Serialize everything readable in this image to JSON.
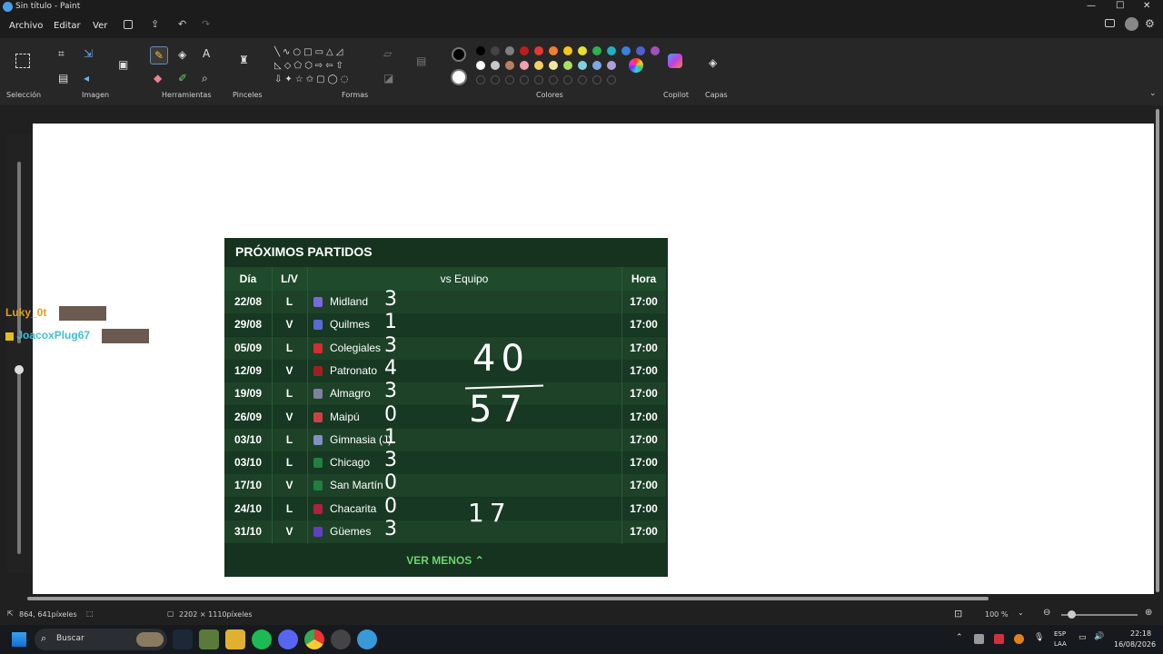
{
  "window": {
    "title": "Sin título - Paint",
    "controls": [
      "—",
      "□",
      "✕"
    ]
  },
  "menu": [
    "Archivo",
    "Editar",
    "Ver"
  ],
  "ribbon": {
    "groups": [
      "Selección",
      "Imagen",
      "Herramientas",
      "Pinceles",
      "Formas",
      "Colores",
      "Copilot",
      "Capas"
    ],
    "palette_row1": [
      "#000000",
      "#444444",
      "#7f7f7f",
      "#c01c1c",
      "#e53935",
      "#f08030",
      "#f5c518",
      "#e8e030",
      "#30b050",
      "#20b0c0",
      "#3a80e0",
      "#5060d0",
      "#a050c0"
    ],
    "palette_row2": [
      "#ffffff",
      "#c8c8c8",
      "#b88060",
      "#f0a0b0",
      "#f5d060",
      "#f0e8a0",
      "#a8e060",
      "#80d0e0",
      "#80a8e0",
      "#b0a0d8"
    ]
  },
  "chat": [
    {
      "user": "Luky_0t",
      "color": "#e0a020"
    },
    {
      "user": "JoacoxPlug67",
      "color": "#40c0d0"
    }
  ],
  "widget": {
    "title": "PRÓXIMOS PARTIDOS",
    "columns": [
      "Día",
      "L/V",
      "vs Equipo",
      "Hora"
    ],
    "rows": [
      {
        "dia": "22/08",
        "lv": "L",
        "equipo": "Midland",
        "hora": "17:00",
        "score": "3",
        "crest": "#7a6ad8"
      },
      {
        "dia": "29/08",
        "lv": "V",
        "equipo": "Quilmes",
        "hora": "17:00",
        "score": "1",
        "crest": "#5a6ad0"
      },
      {
        "dia": "05/09",
        "lv": "L",
        "equipo": "Colegiales",
        "hora": "17:00",
        "score": "3",
        "crest": "#d03030"
      },
      {
        "dia": "12/09",
        "lv": "V",
        "equipo": "Patronato",
        "hora": "17:00",
        "score": "4",
        "crest": "#a02020"
      },
      {
        "dia": "19/09",
        "lv": "L",
        "equipo": "Almagro",
        "hora": "17:00",
        "score": "3",
        "crest": "#8080a0"
      },
      {
        "dia": "26/09",
        "lv": "V",
        "equipo": "Maipú",
        "hora": "17:00",
        "score": "0",
        "crest": "#d04040"
      },
      {
        "dia": "03/10",
        "lv": "L",
        "equipo": "Gimnasia (J)",
        "hora": "17:00",
        "score": "1",
        "crest": "#8090c0"
      },
      {
        "dia": "03/10",
        "lv": "L",
        "equipo": "Chicago",
        "hora": "17:00",
        "score": "3",
        "crest": "#208040"
      },
      {
        "dia": "17/10",
        "lv": "V",
        "equipo": "San Martín",
        "hora": "17:00",
        "score": "0",
        "crest": "#208040"
      },
      {
        "dia": "24/10",
        "lv": "L",
        "equipo": "Chacarita",
        "hora": "17:00",
        "score": "0",
        "crest": "#b02040"
      },
      {
        "dia": "31/10",
        "lv": "V",
        "equipo": "Güemes",
        "hora": "17:00",
        "score": "3",
        "crest": "#6040c0"
      }
    ],
    "button": "VER MENOS ⌃"
  },
  "annotations": {
    "top": "40",
    "bottom": "57",
    "side": "17"
  },
  "status": {
    "cursor": "864, 641píxeles",
    "size": "2202 × 1110píxeles",
    "zoom": "100 %"
  },
  "taskbar": {
    "search": "Buscar",
    "lang1": "ESP",
    "lang2": "LAA",
    "time": "22:18",
    "date": "16/08/2026"
  }
}
